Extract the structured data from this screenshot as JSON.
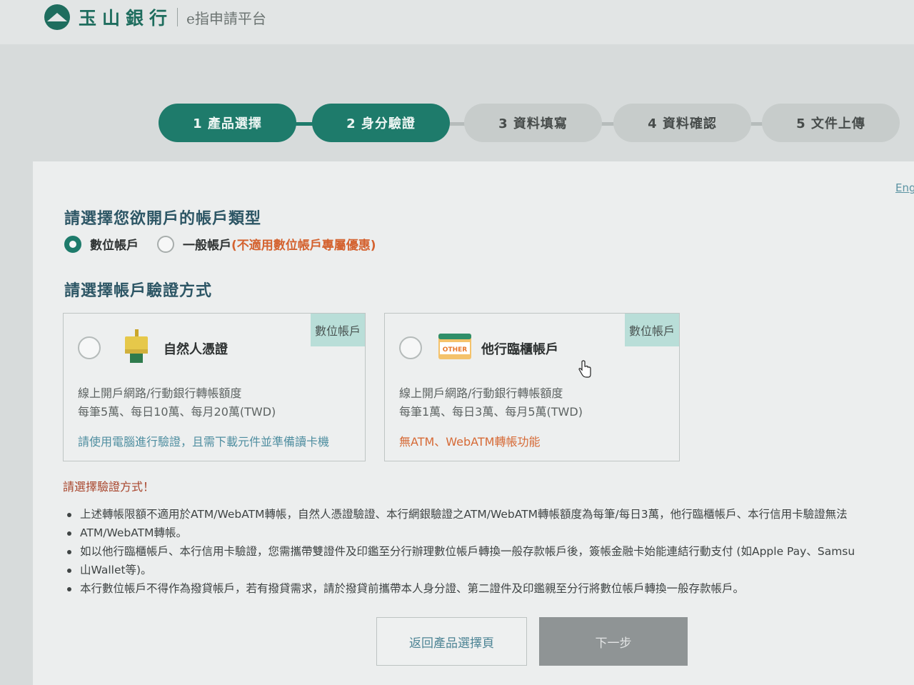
{
  "header": {
    "bank_name": "玉山銀行",
    "platform_name": "e指申請平台"
  },
  "stepper": {
    "steps": [
      {
        "label": "1 產品選擇",
        "state": "completed"
      },
      {
        "label": "2 身分驗證",
        "state": "current"
      },
      {
        "label": "3 資料填寫",
        "state": "pending"
      },
      {
        "label": "4 資料確認",
        "state": "pending"
      },
      {
        "label": "5 文件上傳",
        "state": "pending"
      }
    ]
  },
  "language_link": "English",
  "account_type": {
    "title": "請選擇您欲開戶的帳戶類型",
    "options": [
      {
        "label": "數位帳戶",
        "selected": true
      },
      {
        "label": "一般帳戶",
        "note": "(不適用數位帳戶專屬優惠)",
        "selected": false
      }
    ]
  },
  "verification": {
    "title": "請選擇帳戶驗證方式",
    "cards": [
      {
        "tag": "數位帳戶",
        "icon": "certificate-card-reader-icon",
        "title": "自然人憑證",
        "line1": "線上開戶網路/行動銀行轉帳額度",
        "line2": "每筆5萬、每日10萬、每月20萬(TWD)",
        "note": "請使用電腦進行驗證，且需下載元件並準備讀卡機",
        "selected": false
      },
      {
        "tag": "數位帳戶",
        "icon": "other-bank-card-icon",
        "icon_text": "OTHER",
        "title": "他行臨櫃帳戶",
        "line1": "線上開戶網路/行動銀行轉帳額度",
        "line2": "每筆1萬、每日3萬、每月5萬(TWD)",
        "note": "無ATM、WebATM轉帳功能",
        "selected": false
      }
    ],
    "error": "請選擇驗證方式！"
  },
  "notes": [
    "上述轉帳限額不適用於ATM/WebATM轉帳，自然人憑證驗證、本行網銀驗證之ATM/WebATM轉帳額度為每筆/每日3萬，他行臨櫃帳戶、本行信用卡驗證無法",
    "ATM/WebATM轉帳。",
    "如以他行臨櫃帳戶、本行信用卡驗證，您需攜帶雙證件及印鑑至分行辦理數位帳戶轉換一般存款帳戶後，簽帳金融卡始能連結行動支付 (如Apple Pay、Samsu",
    "山Wallet等)。",
    "本行數位帳戶不得作為撥貸帳戶，若有撥貸需求，請於撥貸前攜帶本人身分證、第二證件及印鑑親至分行將數位帳戶轉換一般存款帳戶。"
  ],
  "buttons": {
    "back": "返回產品選擇頁",
    "next": "下一步"
  },
  "colors": {
    "brand": "#1e7b6b",
    "warning": "#d4622f",
    "tag_bg": "#b9ded8"
  }
}
